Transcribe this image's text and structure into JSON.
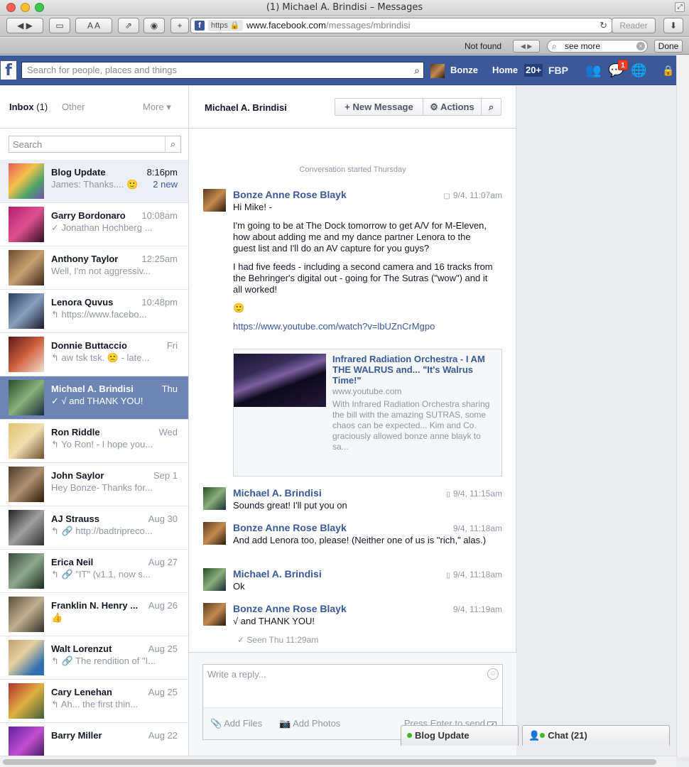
{
  "window": {
    "title": "(1) Michael A. Brindisi – Messages"
  },
  "browser": {
    "url_scheme": "https",
    "url_domain": "www.facebook.com",
    "url_path": "/messages/mbrindisi",
    "reader_label": "Reader",
    "find_status": "Not found",
    "find_query": "see more",
    "done_label": "Done"
  },
  "fb": {
    "logo": "f",
    "search_placeholder": "Search for people, places and things",
    "user_name": "Bonze",
    "home_label": "Home",
    "home_count": "20+",
    "fbp_label": "FBP",
    "messages_badge": "1"
  },
  "inbox": {
    "label": "Inbox",
    "count": "(1)",
    "other_label": "Other",
    "more_label": "More ▾",
    "search_placeholder": "Search",
    "threads": [
      {
        "name": "Blog Update",
        "time": "8:16pm",
        "snippet": "James: Thanks.... 🙂",
        "extra": "2 new"
      },
      {
        "name": "Garry Bordonaro",
        "time": "10:08am",
        "snippet": "✓ Jonathan Hochberg ..."
      },
      {
        "name": "Anthony Taylor",
        "time": "12:25am",
        "snippet": "Well, I'm not aggressiv..."
      },
      {
        "name": "Lenora Quvus",
        "time": "10:48pm",
        "snippet": "↰ https://www.facebo..."
      },
      {
        "name": "Donnie Buttaccio",
        "time": "Fri",
        "snippet": "↰ aw tsk tsk. 🙁 - late..."
      },
      {
        "name": "Michael A. Brindisi",
        "time": "Thu",
        "snippet": "✓ √ and THANK YOU!"
      },
      {
        "name": "Ron Riddle",
        "time": "Wed",
        "snippet": "↰ Yo Ron! - I hope you..."
      },
      {
        "name": "John Saylor",
        "time": "Sep 1",
        "snippet": "Hey Bonze- Thanks for..."
      },
      {
        "name": "AJ Strauss",
        "time": "Aug 30",
        "snippet": "↰ 🔗 http://badtripreco..."
      },
      {
        "name": "Erica Neil",
        "time": "Aug 27",
        "snippet": "↰ 🔗 \"IT\" (v1.1, now s..."
      },
      {
        "name": "Franklin N. Henry ...",
        "time": "Aug 26",
        "snippet": ""
      },
      {
        "name": "Walt Lorenzut",
        "time": "Aug 25",
        "snippet": "↰ 🔗 The rendition of \"I..."
      },
      {
        "name": "Cary Lenehan",
        "time": "Aug 25",
        "snippet": "↰ Ah... the first thin..."
      },
      {
        "name": "Barry Miller",
        "time": "Aug 22",
        "snippet": ""
      }
    ]
  },
  "conversation": {
    "title": "Michael A. Brindisi",
    "new_message_label": "+ New Message",
    "actions_label": "⚙ Actions",
    "started_label": "Conversation started Thursday",
    "messages": [
      {
        "sender": "Bonze Anne Rose Blayk",
        "time": "9/4, 11:07am"
      },
      {
        "sender": "Michael A. Brindisi",
        "time": "9/4, 11:15am",
        "text": "Sounds great! I'll put you on"
      },
      {
        "sender": "Bonze Anne Rose Blayk",
        "time": "9/4, 11:18am",
        "text": "And add Lenora too, please!  (Neither one of us is \"rich,\" alas.)"
      },
      {
        "sender": "Michael A. Brindisi",
        "time": "9/4, 11:18am",
        "text": "Ok"
      },
      {
        "sender": "Bonze Anne Rose Blayk",
        "time": "9/4, 11:19am",
        "text": "√ and THANK YOU!"
      }
    ],
    "first_message": {
      "p1": "Hi Mike! -",
      "p2": "I'm going to be at The Dock tomorrow to get A/V for M-Eleven, how about adding me and my dance partner Lenora to the guest list and I'll do an AV capture for you guys?",
      "p3": "I had five feeds - including a second camera and 16 tracks from the Behringer's digital out - going for The Sutras (\"wow\") and it all worked!",
      "emoji": "🙂",
      "link": "https://www.youtube.com/watch?v=lbUZnCrMgpo"
    },
    "share": {
      "title": "Infrared Radiation Orchestra - I AM THE WALRUS and... \"It's Walrus Time!\"",
      "domain": "www.youtube.com",
      "description": "With Infrared Radiation Orchestra sharing the bill with the amazing SUTRAS, some chaos can be expected... Kim and Co. graciously allowed bonze anne blayk to sa..."
    },
    "seen_label": "✓ Seen Thu 11:29am"
  },
  "composer": {
    "placeholder": "Write a reply...",
    "add_files": "Add Files",
    "add_photos": "Add Photos",
    "press_enter": "Press Enter to send"
  },
  "chat": {
    "blog_tab": "Blog Update",
    "chat_tab": "Chat (21)"
  },
  "colors": {
    "fb_blue": "#3b5998",
    "selected_row": "#6d84b4",
    "unread_row": "#eceff5",
    "badge_red": "#f03d25"
  }
}
